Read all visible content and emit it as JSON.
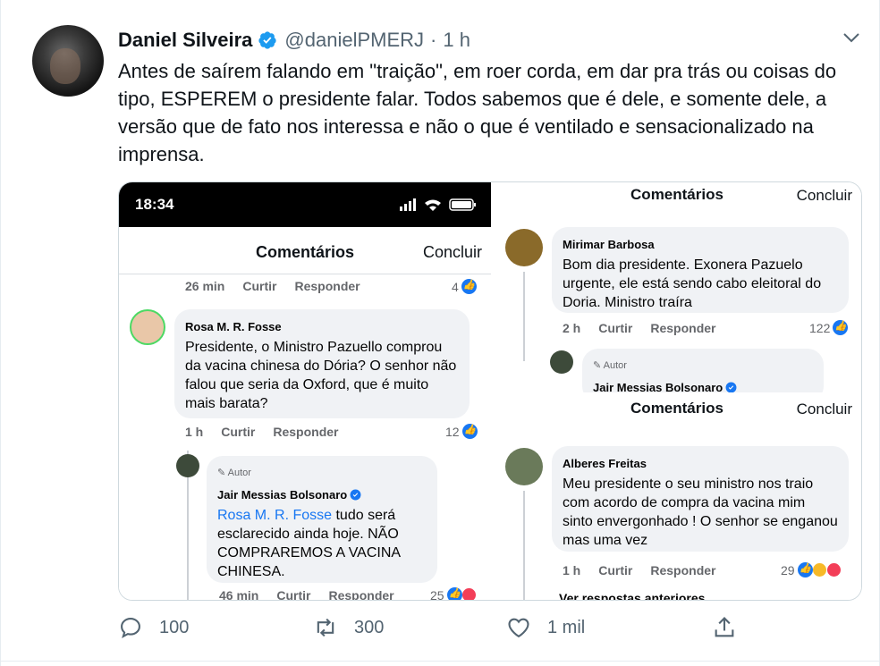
{
  "tweet": {
    "author_name": "Daniel Silveira",
    "handle": "@danielPMERJ",
    "separator": "·",
    "time": "1 h",
    "text": "Antes de saírem falando em \"traição\", em roer corda, em dar pra trás ou coisas do tipo, ESPEREM o presidente falar. Todos sabemos que é dele, e somente dele, a versão que de fato nos interessa e não o que é ventilado e sensacionalizado na imprensa."
  },
  "media": {
    "left": {
      "status_time": "18:34",
      "title": "Comentários",
      "done": "Concluir",
      "top_meta": {
        "time": "26 min",
        "like": "Curtir",
        "reply": "Responder",
        "count": "4"
      },
      "comment1": {
        "author": "Rosa M. R. Fosse",
        "text": "Presidente, o Ministro Pazuello comprou da vacina chinesa do Dória? O senhor não falou que  seria da Oxford, que é muito mais barata?",
        "meta": {
          "time": "1 h",
          "like": "Curtir",
          "reply": "Responder",
          "count": "12"
        }
      },
      "reply1": {
        "tag": "Autor",
        "author": "Jair Messias Bolsonaro",
        "mention": "Rosa M. R. Fosse",
        "text": " tudo será esclarecido ainda hoje. NÃO COMPRAREMOS A VACINA CHINESA.",
        "meta": {
          "time": "46 min",
          "like": "Curtir",
          "reply": "Responder",
          "count": "25"
        }
      }
    },
    "right_top": {
      "title": "Comentários",
      "done": "Concluir",
      "comment": {
        "author": "Mirimar Barbosa",
        "text": "Bom dia presidente.  Exonera  Pazuelo urgente, ele está  sendo cabo  eleitoral do Doria.  Ministro traíra",
        "meta": {
          "time": "2 h",
          "like": "Curtir",
          "reply": "Responder",
          "count": "122"
        }
      },
      "reply": {
        "tag": "Autor",
        "author": "Jair Messias Bolsonaro"
      }
    },
    "right_bottom": {
      "title": "Comentários",
      "done": "Concluir",
      "comment": {
        "author": "Alberes Freitas",
        "text": "Meu presidente o seu ministro nos traio com acordo de compra da vacina mim sinto envergonhado ! O senhor se enganou mas uma vez",
        "meta": {
          "time": "1 h",
          "like": "Curtir",
          "reply": "Responder",
          "count": "29"
        }
      },
      "more": "Ver respostas anteriores"
    }
  },
  "actions": {
    "reply_count": "100",
    "retweet_count": "300",
    "like_count": "1 mil"
  },
  "colors": {
    "twitter_blue": "#1d9bf0",
    "facebook_blue": "#1877f2",
    "muted": "#536471"
  }
}
